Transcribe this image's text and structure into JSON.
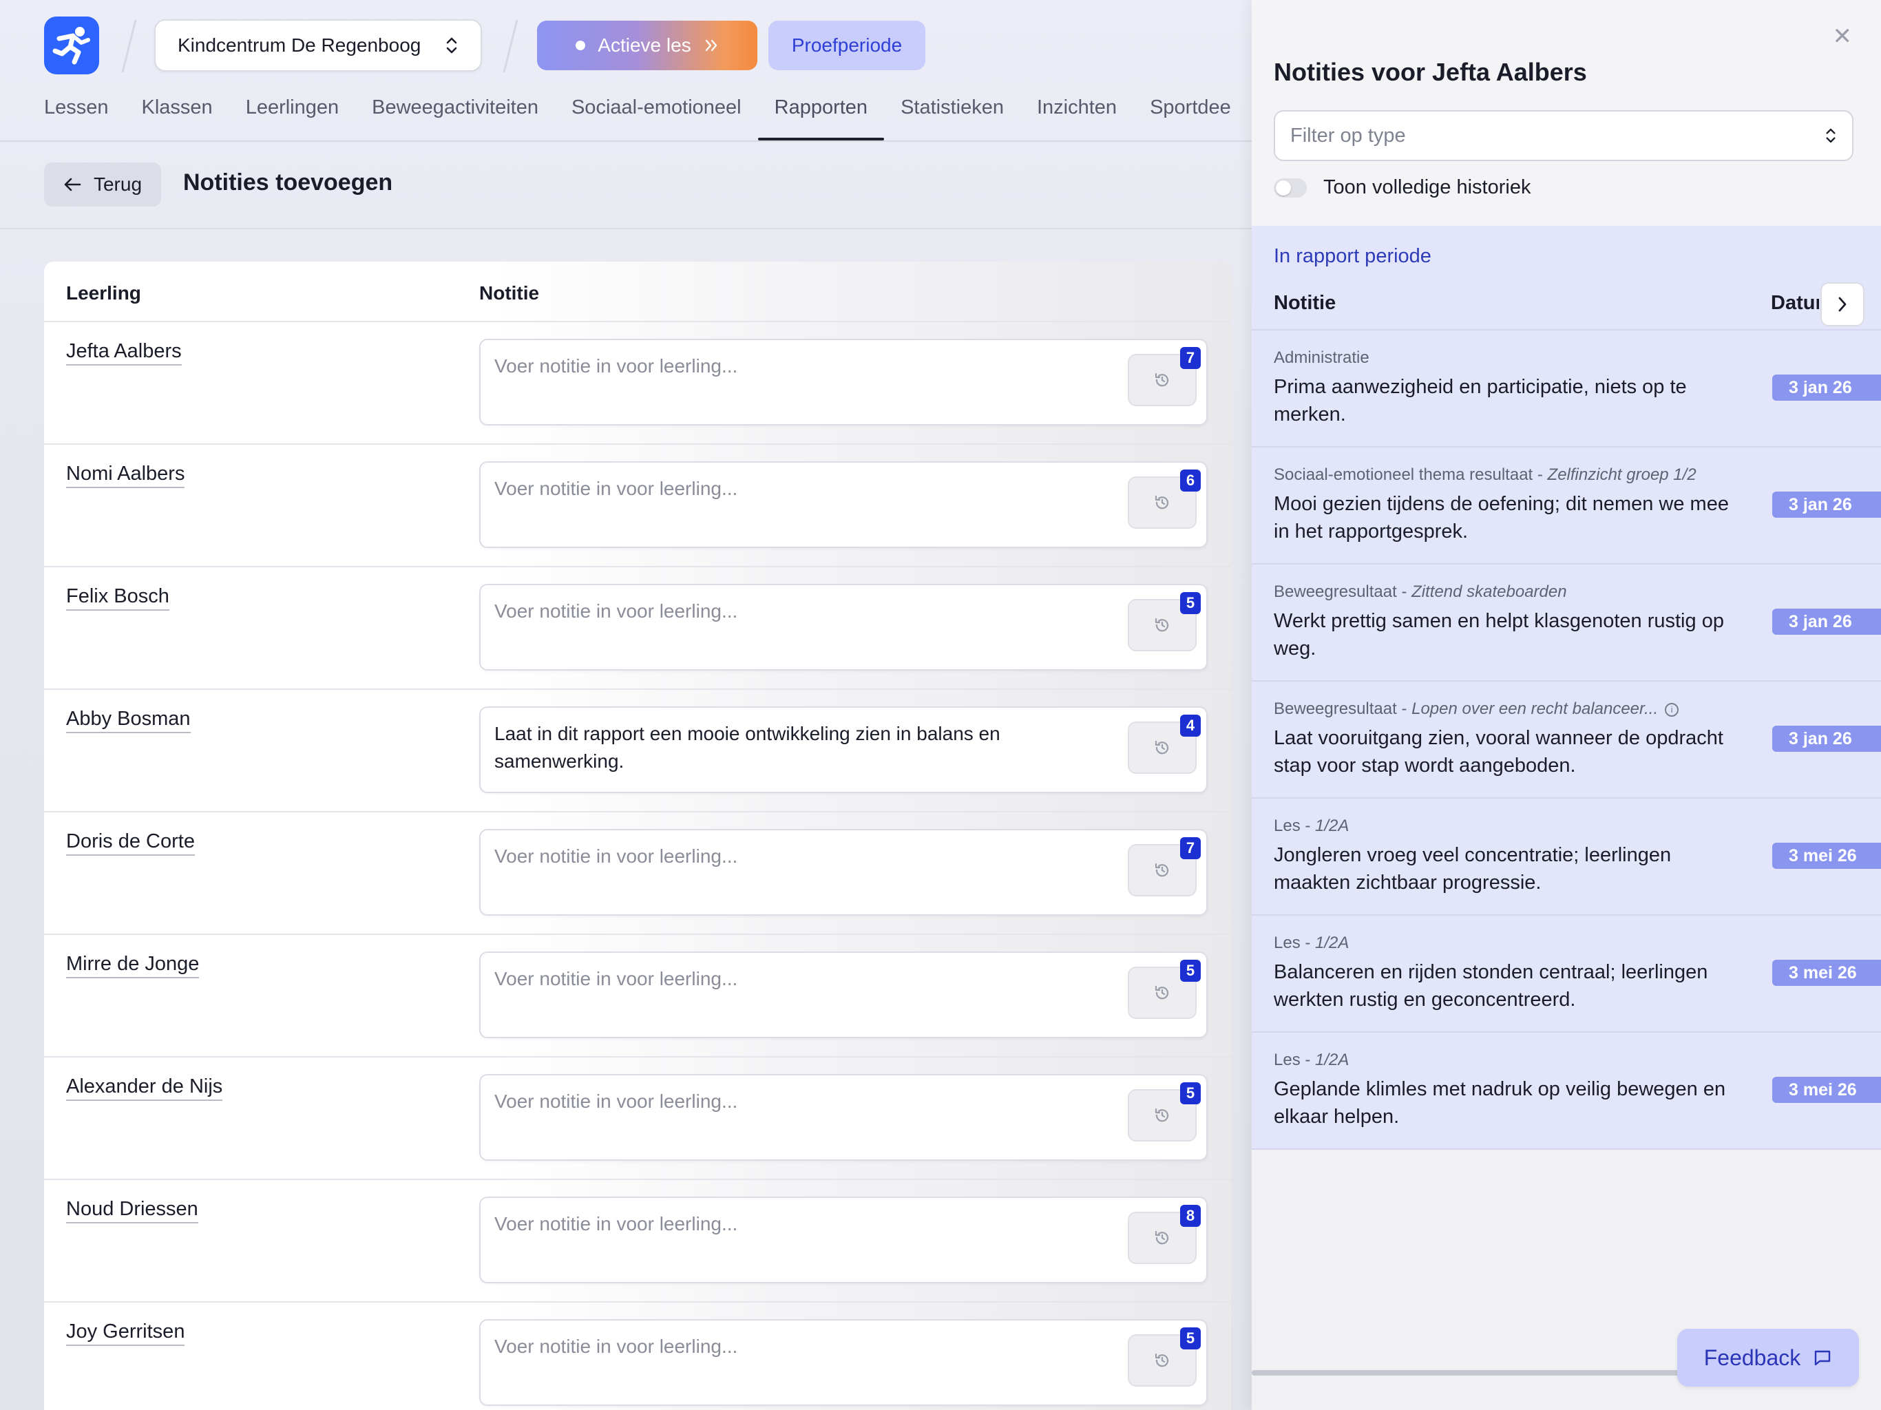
{
  "header": {
    "school": "Kindcentrum De Regenboog",
    "active_lesson": "Actieve les",
    "trial": "Proefperiode",
    "nav": [
      "Lessen",
      "Klassen",
      "Leerlingen",
      "Beweegactiviteiten",
      "Sociaal-emotioneel",
      "Rapporten",
      "Statistieken",
      "Inzichten",
      "Sportdee"
    ],
    "active_nav": "Rapporten"
  },
  "subbar": {
    "back": "Terug",
    "title": "Notities toevoegen"
  },
  "table": {
    "col_student": "Leerling",
    "col_note": "Notitie",
    "placeholder": "Voer notitie in voor leerling...",
    "rows": [
      {
        "name": "Jefta Aalbers",
        "note": "",
        "count": "7"
      },
      {
        "name": "Nomi Aalbers",
        "note": "",
        "count": "6"
      },
      {
        "name": "Felix Bosch",
        "note": "",
        "count": "5"
      },
      {
        "name": "Abby Bosman",
        "note": "Laat in dit rapport een mooie ontwikkeling zien in balans en samenwerking.",
        "count": "4"
      },
      {
        "name": "Doris de Corte",
        "note": "",
        "count": "7"
      },
      {
        "name": "Mirre de Jonge",
        "note": "",
        "count": "5"
      },
      {
        "name": "Alexander de Nijs",
        "note": "",
        "count": "5"
      },
      {
        "name": "Noud Driessen",
        "note": "",
        "count": "8"
      },
      {
        "name": "Joy Gerritsen",
        "note": "",
        "count": "5"
      }
    ]
  },
  "panel": {
    "title": "Notities voor Jefta Aalbers",
    "filter_placeholder": "Filter op type",
    "toggle_label": "Toon volledige historiek",
    "period_label": "In rapport periode",
    "col_note": "Notitie",
    "col_date": "Datum",
    "items": [
      {
        "type": "Administratie",
        "sub": "",
        "info": false,
        "text": "Prima aanwezigheid en participatie, niets op te merken.",
        "date": "3 jan 26"
      },
      {
        "type": "Sociaal-emotioneel thema resultaat",
        "sub": "Zelfinzicht groep 1/2",
        "info": false,
        "text": "Mooi gezien tijdens de oefening; dit nemen we mee in het rapportgesprek.",
        "date": "3 jan 26"
      },
      {
        "type": "Beweegresultaat",
        "sub": "Zittend skateboarden",
        "info": false,
        "text": "Werkt prettig samen en helpt klasgenoten rustig op weg.",
        "date": "3 jan 26"
      },
      {
        "type": "Beweegresultaat",
        "sub": "Lopen over een recht balanceer...",
        "info": true,
        "text": "Laat vooruitgang zien, vooral wanneer de opdracht stap voor stap wordt aangeboden.",
        "date": "3 jan 26"
      },
      {
        "type": "Les",
        "sub": "1/2A",
        "info": false,
        "text": "Jongleren vroeg veel concentratie; leerlingen maakten zichtbaar progressie.",
        "date": "3 mei 26"
      },
      {
        "type": "Les",
        "sub": "1/2A",
        "info": false,
        "text": "Balanceren en rijden stonden centraal; leerlingen werkten rustig en geconcentreerd.",
        "date": "3 mei 26"
      },
      {
        "type": "Les",
        "sub": "1/2A",
        "info": false,
        "text": "Geplande klimles met nadruk op veilig bewegen en elkaar helpen.",
        "date": "3 mei 26"
      }
    ]
  },
  "feedback": "Feedback",
  "colors": {
    "accent": "#1b2fd3",
    "badge": "#8a95ef",
    "brand": "#2d63ff"
  },
  "icons": {
    "logo": "runner-logo-icon",
    "history": "history-icon",
    "close": "close-icon"
  }
}
